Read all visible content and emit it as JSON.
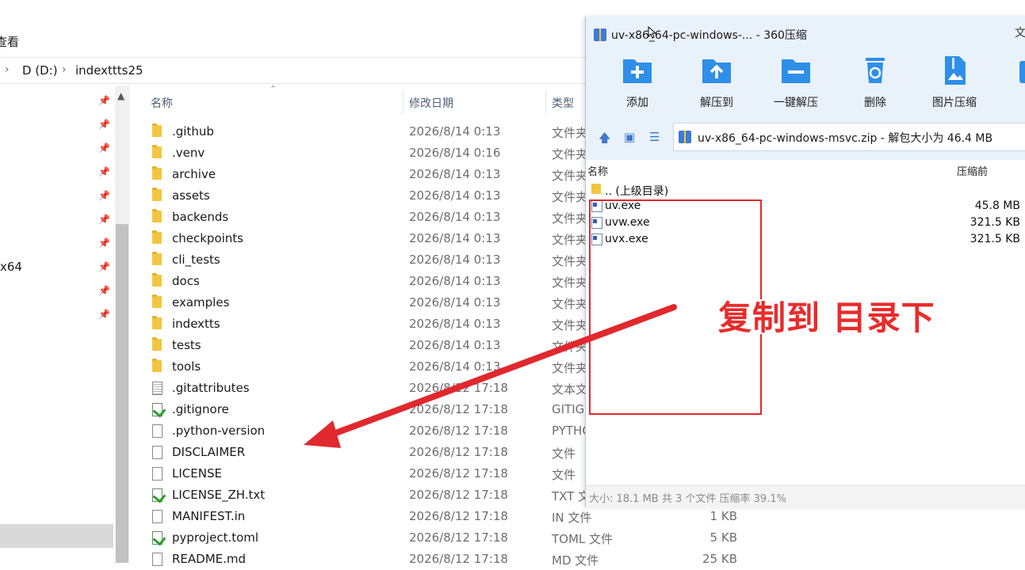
{
  "explorer": {
    "menu_partial": "查看",
    "address": {
      "drive": "D (D:)",
      "folder": "indexttts25"
    },
    "nav_label": "x64",
    "columns": {
      "name": "名称",
      "date": "修改日期",
      "type": "类型"
    },
    "rows": [
      {
        "icon": "folder-icon",
        "name": ".github",
        "date": "2026/8/14 0:13",
        "type": "文件夹",
        "size": ""
      },
      {
        "icon": "folder-icon",
        "name": ".venv",
        "date": "2026/8/14 0:16",
        "type": "文件夹",
        "size": ""
      },
      {
        "icon": "folder-icon",
        "name": "archive",
        "date": "2026/8/14 0:13",
        "type": "文件夹",
        "size": ""
      },
      {
        "icon": "folder-icon",
        "name": "assets",
        "date": "2026/8/14 0:13",
        "type": "文件夹",
        "size": ""
      },
      {
        "icon": "folder-icon",
        "name": "backends",
        "date": "2026/8/14 0:13",
        "type": "文件夹",
        "size": ""
      },
      {
        "icon": "folder-icon",
        "name": "checkpoints",
        "date": "2026/8/14 0:13",
        "type": "文件夹",
        "size": ""
      },
      {
        "icon": "folder-icon",
        "name": "cli_tests",
        "date": "2026/8/14 0:13",
        "type": "文件夹",
        "size": ""
      },
      {
        "icon": "folder-icon",
        "name": "docs",
        "date": "2026/8/14 0:13",
        "type": "文件夹",
        "size": ""
      },
      {
        "icon": "folder-icon",
        "name": "examples",
        "date": "2026/8/14 0:13",
        "type": "文件夹",
        "size": ""
      },
      {
        "icon": "folder-icon",
        "name": "indextts",
        "date": "2026/8/14 0:13",
        "type": "文件夹",
        "size": ""
      },
      {
        "icon": "folder-icon",
        "name": "tests",
        "date": "2026/8/14 0:13",
        "type": "文件夹",
        "size": ""
      },
      {
        "icon": "folder-icon",
        "name": "tools",
        "date": "2026/8/14 0:13",
        "type": "文件夹",
        "size": ""
      },
      {
        "icon": "text-file-icon",
        "name": ".gitattributes",
        "date": "2026/8/12 17:18",
        "type": "文本文",
        "size": ""
      },
      {
        "icon": "editable-file-icon",
        "name": ".gitignore",
        "date": "2026/8/12 17:18",
        "type": "GITIGI",
        "size": ""
      },
      {
        "icon": "file-icon",
        "name": ".python-version",
        "date": "2026/8/12 17:18",
        "type": "PYTHO",
        "size": ""
      },
      {
        "icon": "file-icon",
        "name": "DISCLAIMER",
        "date": "2026/8/12 17:18",
        "type": "文件",
        "size": ""
      },
      {
        "icon": "file-icon",
        "name": "LICENSE",
        "date": "2026/8/12 17:18",
        "type": "文件",
        "size": ""
      },
      {
        "icon": "editable-file-icon",
        "name": "LICENSE_ZH.txt",
        "date": "2026/8/12 17:18",
        "type": "TXT 文",
        "size": ""
      },
      {
        "icon": "file-icon",
        "name": "MANIFEST.in",
        "date": "2026/8/12 17:18",
        "type": "IN 文件",
        "size": "1 KB"
      },
      {
        "icon": "editable-file-icon",
        "name": "pyproject.toml",
        "date": "2026/8/12 17:18",
        "type": "TOML 文件",
        "size": "5 KB"
      },
      {
        "icon": "file-icon",
        "name": "README.md",
        "date": "2026/8/12 17:18",
        "type": "MD 文件",
        "size": "25 KB"
      }
    ]
  },
  "zip": {
    "title": "uv-x86_64-pc-windows-... - 360压缩",
    "title_right": "文",
    "tools": [
      {
        "label": "添加",
        "icon": "add-folder-icon"
      },
      {
        "label": "解压到",
        "icon": "extract-to-icon"
      },
      {
        "label": "一键解压",
        "icon": "one-click-extract-icon"
      },
      {
        "label": "删除",
        "icon": "trash-icon"
      },
      {
        "label": "图片压缩",
        "icon": "image-compress-icon"
      }
    ],
    "path_text": "uv-x86_64-pc-windows-msvc.zip - 解包大小为 46.4 MB",
    "list_head": {
      "name": "名称",
      "compressed": "压缩前"
    },
    "items": [
      {
        "name": ".. (上级目录)",
        "size": "",
        "kind": "parent"
      },
      {
        "name": "uv.exe",
        "size": "45.8 MB",
        "kind": "file"
      },
      {
        "name": "uvw.exe",
        "size": "321.5 KB",
        "kind": "file"
      },
      {
        "name": "uvx.exe",
        "size": "321.5 KB",
        "kind": "file"
      }
    ],
    "status": "大小: 18.1 MB 共 3 个文件 压缩率 39.1%"
  },
  "annotation": {
    "callout": "复制到 目录下",
    "color": "#ea2b2b"
  }
}
